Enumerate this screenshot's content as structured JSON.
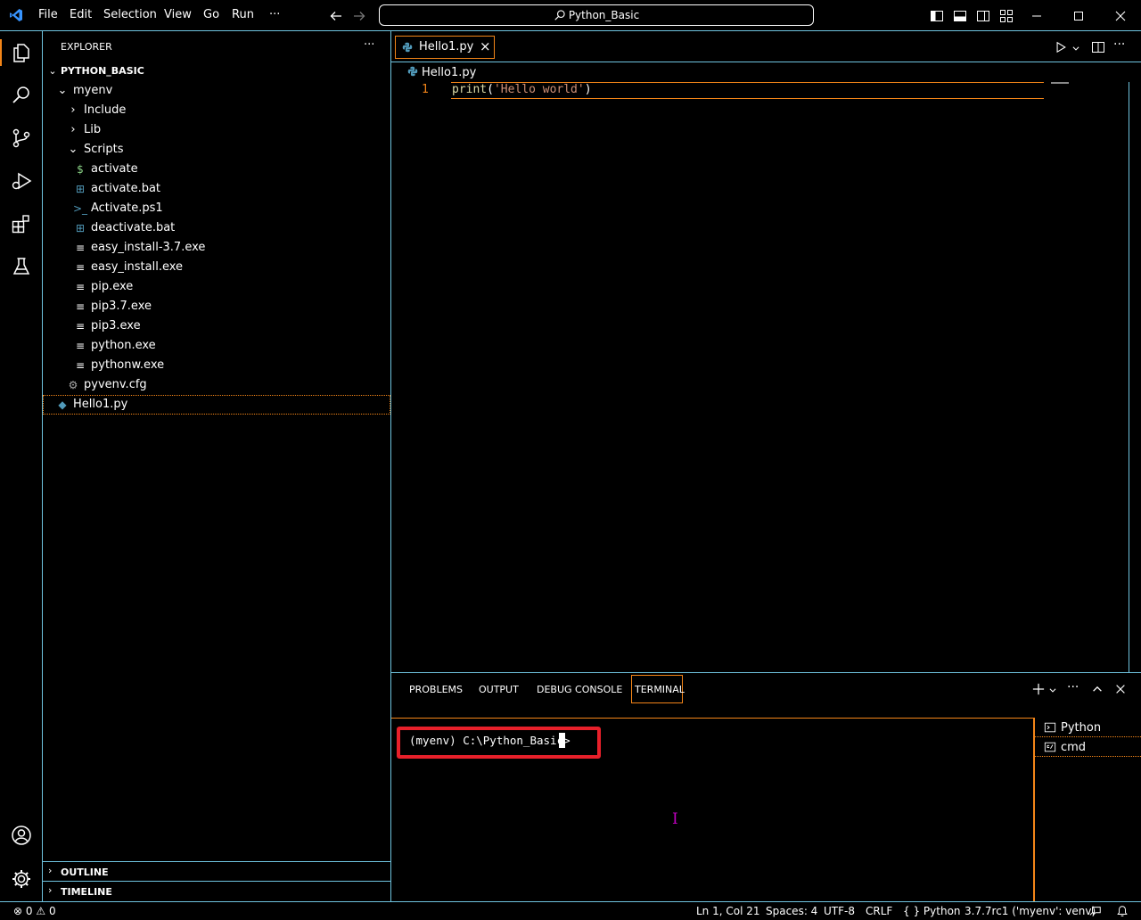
{
  "menu": [
    "File",
    "Edit",
    "Selection",
    "View",
    "Go",
    "Run",
    "···"
  ],
  "search": {
    "label": "Python_Basic"
  },
  "explorer": {
    "title": "EXPLORER",
    "more": "···",
    "root": "PYTHON_BASIC",
    "tree": [
      {
        "label": "myenv",
        "type": "folder-open",
        "depth": 1
      },
      {
        "label": "Include",
        "type": "folder-closed",
        "depth": 2
      },
      {
        "label": "Lib",
        "type": "folder-closed",
        "depth": 2
      },
      {
        "label": "Scripts",
        "type": "folder-open",
        "depth": 2
      },
      {
        "label": "activate",
        "type": "shell",
        "depth": 3
      },
      {
        "label": "activate.bat",
        "type": "windows",
        "depth": 3
      },
      {
        "label": "Activate.ps1",
        "type": "powershell",
        "depth": 3
      },
      {
        "label": "deactivate.bat",
        "type": "windows",
        "depth": 3
      },
      {
        "label": "easy_install-3.7.exe",
        "type": "file",
        "depth": 3
      },
      {
        "label": "easy_install.exe",
        "type": "file",
        "depth": 3
      },
      {
        "label": "pip.exe",
        "type": "file",
        "depth": 3
      },
      {
        "label": "pip3.7.exe",
        "type": "file",
        "depth": 3
      },
      {
        "label": "pip3.exe",
        "type": "file",
        "depth": 3
      },
      {
        "label": "python.exe",
        "type": "file",
        "depth": 3
      },
      {
        "label": "pythonw.exe",
        "type": "file",
        "depth": 3
      },
      {
        "label": "pyvenv.cfg",
        "type": "gear",
        "depth": 2
      },
      {
        "label": "Hello1.py",
        "type": "python",
        "depth": 1
      }
    ],
    "outline": "OUTLINE",
    "timeline": "TIMELINE"
  },
  "editor": {
    "tab": "Hello1.py",
    "tab_close": "×",
    "breadcrumb": "Hello1.py",
    "line_number": "1",
    "code_fn": "print",
    "code_paren_open": "(",
    "code_str": "'Hello world'",
    "code_paren_close": ")"
  },
  "panel": {
    "tabs": [
      "PROBLEMS",
      "OUTPUT",
      "DEBUG CONSOLE",
      "TERMINAL"
    ],
    "prompt": "(myenv) C:\\Python_Basic>",
    "terminals": [
      "Python",
      "cmd"
    ]
  },
  "status": {
    "errors": "0",
    "warnings": "0",
    "position": "Ln 1, Col 21",
    "spaces": "Spaces: 4",
    "encoding": "UTF-8",
    "eol": "CRLF",
    "language": "Python",
    "interpreter": "3.7.7rc1 ('myenv': venv)"
  },
  "colors": {
    "contrast_border": "#6fc3df",
    "active_border": "#f38518",
    "highlight_box": "#e8202a",
    "string": "#ce9178",
    "function": "#dcdcaa",
    "python_blue": "#519aba"
  }
}
